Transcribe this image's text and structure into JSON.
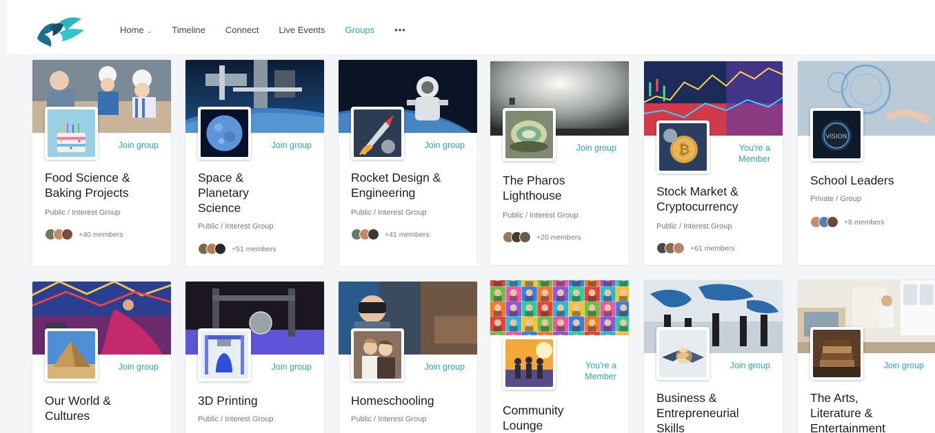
{
  "nav": {
    "items": [
      {
        "label": "Home",
        "has_caret": true,
        "active": false,
        "name": "nav-home"
      },
      {
        "label": "Timeline",
        "active": false,
        "name": "nav-timeline"
      },
      {
        "label": "Connect",
        "active": false,
        "name": "nav-connect"
      },
      {
        "label": "Live Events",
        "active": false,
        "name": "nav-live-events"
      },
      {
        "label": "Groups",
        "active": true,
        "name": "nav-groups"
      }
    ],
    "more_label": "•••",
    "accent_color": "#2aa6ac"
  },
  "groups": [
    {
      "title_lines": [
        "Food Science &",
        "Baking Projects"
      ],
      "meta": "Public / Interest Group",
      "members": "+40 members",
      "action": "Join group",
      "icon": "birthday-cake-icon",
      "cover": "kids-baking-photo"
    },
    {
      "title_lines": [
        "Space &",
        "Planetary",
        "Science"
      ],
      "meta": "Public / Interest Group",
      "members": "+51 members",
      "action": "Join group",
      "icon": "moon-icon",
      "cover": "space-station-photo"
    },
    {
      "title_lines": [
        "Rocket Design &",
        "Engineering"
      ],
      "meta": "Public / Interest Group",
      "members": "+41 members",
      "action": "Join group",
      "icon": "rocket-launch-icon",
      "cover": "astronaut-photo"
    },
    {
      "title_lines": [
        "The Pharos",
        "Lighthouse"
      ],
      "meta": "Public / Interest Group",
      "members": "+20 members",
      "action": "Join group",
      "icon": "glass-sculpture-icon",
      "cover": "lighthouse-photo"
    },
    {
      "title_lines": [
        "Stock Market &",
        "Cryptocurrency"
      ],
      "meta": "Public / Interest Group",
      "members": "+61 members",
      "action_lines": [
        "You're a",
        "Member"
      ],
      "icon": "bitcoin-icon",
      "cover": "stock-chart-photo"
    },
    {
      "title_lines": [
        "School Leaders"
      ],
      "meta": "Private / Group",
      "members": "+8 members",
      "action": "",
      "icon": "vision-knob-icon",
      "cover": "digital-brain-photo"
    },
    {
      "title_lines": [
        "Our World &",
        "Cultures"
      ],
      "meta": "",
      "members": "",
      "action": "Join group",
      "icon": "pyramid-icon",
      "cover": "festival-photo"
    },
    {
      "title_lines": [
        "3D Printing"
      ],
      "meta": "Public / Interest Group",
      "members": "",
      "action": "Join group",
      "icon": "3d-printer-icon",
      "cover": "3d-printer-photo"
    },
    {
      "title_lines": [
        "Homeschooling"
      ],
      "meta": "Public / Interest Group",
      "members": "",
      "action": "Join group",
      "icon": "children-icon",
      "cover": "vr-kid-photo"
    },
    {
      "title_lines": [
        "Community",
        "Lounge"
      ],
      "meta": "",
      "members": "",
      "action_lines": [
        "You're a",
        "Member"
      ],
      "icon": "friends-silhouette-icon",
      "cover": "people-collage-photo"
    },
    {
      "title_lines": [
        "Business &",
        "Entrepreneurial",
        "Skills"
      ],
      "meta": "",
      "members": "",
      "action": "Join group",
      "icon": "handshake-icon",
      "cover": "business-world-map-photo"
    },
    {
      "title_lines": [
        "The Arts,",
        "Literature &",
        "Entertainment"
      ],
      "meta": "",
      "members": "",
      "action": "Join group",
      "icon": "books-icon",
      "cover": "painter-studio-photo"
    }
  ]
}
